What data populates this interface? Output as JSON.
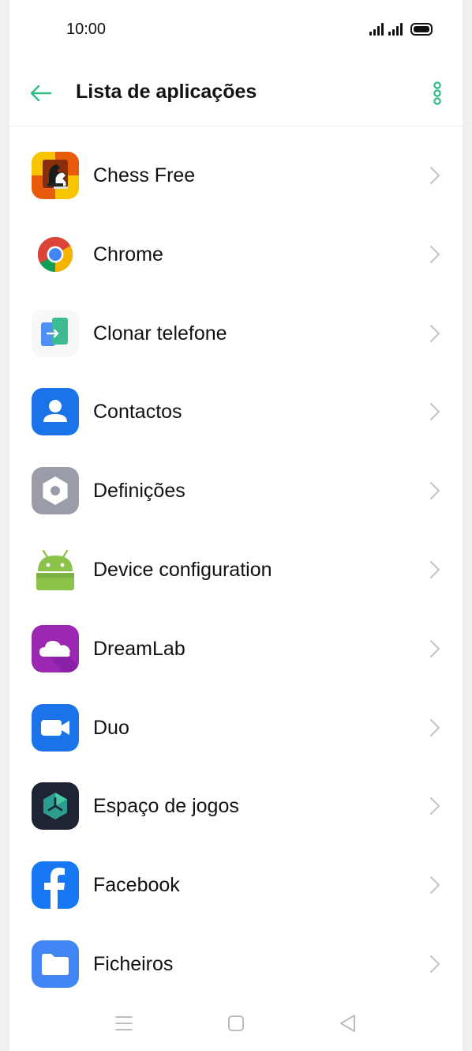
{
  "status_bar": {
    "time": "10:00",
    "icons": [
      "signal-icon",
      "signal-icon",
      "battery-icon"
    ]
  },
  "header": {
    "title": "Lista de aplicações",
    "back_icon": "arrow-left-icon",
    "menu_icon": "more-vertical-icon",
    "accent_color": "#2ebd85"
  },
  "apps": [
    {
      "label": "Chess Free",
      "icon": "chess-free-icon"
    },
    {
      "label": "Chrome",
      "icon": "chrome-icon"
    },
    {
      "label": "Clonar telefone",
      "icon": "clone-phone-icon"
    },
    {
      "label": "Contactos",
      "icon": "contacts-icon"
    },
    {
      "label": "Definições",
      "icon": "settings-icon"
    },
    {
      "label": "Device configuration",
      "icon": "android-icon"
    },
    {
      "label": "DreamLab",
      "icon": "dreamlab-icon"
    },
    {
      "label": "Duo",
      "icon": "duo-icon"
    },
    {
      "label": "Espaço de jogos",
      "icon": "game-space-icon"
    },
    {
      "label": "Facebook",
      "icon": "facebook-icon"
    },
    {
      "label": "Ficheiros",
      "icon": "files-icon"
    }
  ],
  "nav_bar": {
    "icons": [
      "menu-icon",
      "home-icon",
      "back-icon"
    ]
  }
}
